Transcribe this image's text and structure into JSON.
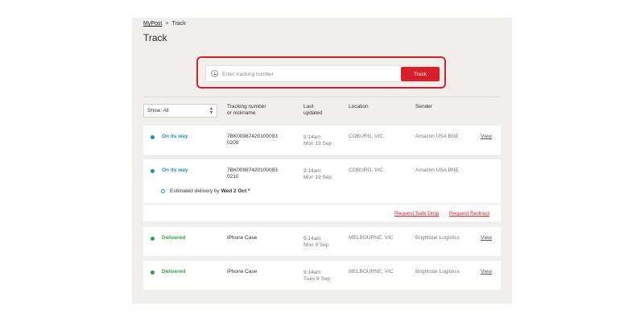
{
  "breadcrumb": {
    "home": "MyPost",
    "separator": ">",
    "current": "Track"
  },
  "page": {
    "title": "Track"
  },
  "search": {
    "placeholder": "Enter tracking number",
    "value": "",
    "button_label": "Track"
  },
  "filter": {
    "label": "Show: All"
  },
  "columns": {
    "tracking": [
      "Tracking number",
      "or nickname"
    ],
    "updated": [
      "Last",
      "updated"
    ],
    "location": "Location",
    "sender": "Sender"
  },
  "shipments": [
    {
      "status": "On its way",
      "tracking": [
        "7BK00987420100093",
        "0209"
      ],
      "time": "9:14am",
      "date": "Mon 19 Sep",
      "location": "COBURG, VIC",
      "sender": "Amazon USA BNE",
      "view": "View"
    },
    {
      "status": "On its way",
      "tracking": [
        "7BK00987420100093",
        "0210"
      ],
      "time": "9:14am",
      "date": "Mon 19 Sep",
      "location": "COBURG, VIC",
      "sender": "Amazon USA BNE",
      "estimate_prefix": "Estimated delivery by",
      "estimate_date": "Wed 2 Oct",
      "estimate_suffix": "*",
      "actions": {
        "safe_drop": "Request Safe Drop",
        "redirect": "Request Redirect"
      }
    },
    {
      "status": "Delivered",
      "tracking": "iPhone Case",
      "time": "9:14am",
      "date": "Mon 9 Sep",
      "location": "MELBOURNE, VIC",
      "sender": "Brightstar Logistics",
      "view": "View"
    },
    {
      "status": "Delivered",
      "tracking": "iPhone Case",
      "time": "9:14am",
      "date": "Tues 8 Sep",
      "location": "MELBOURNE, VIC",
      "sender": "Brightstar Logistics",
      "view": "View"
    }
  ],
  "colors": {
    "accent_red": "#d8202a",
    "on_its_way": "#1b8fc4",
    "delivered": "#2ea044",
    "panel_bg": "#f0efec"
  },
  "icons": {
    "add": "plus-circle-icon",
    "sort": "up-down-arrows-icon",
    "status_dot": "dot-icon",
    "estimate": "ring-icon"
  }
}
